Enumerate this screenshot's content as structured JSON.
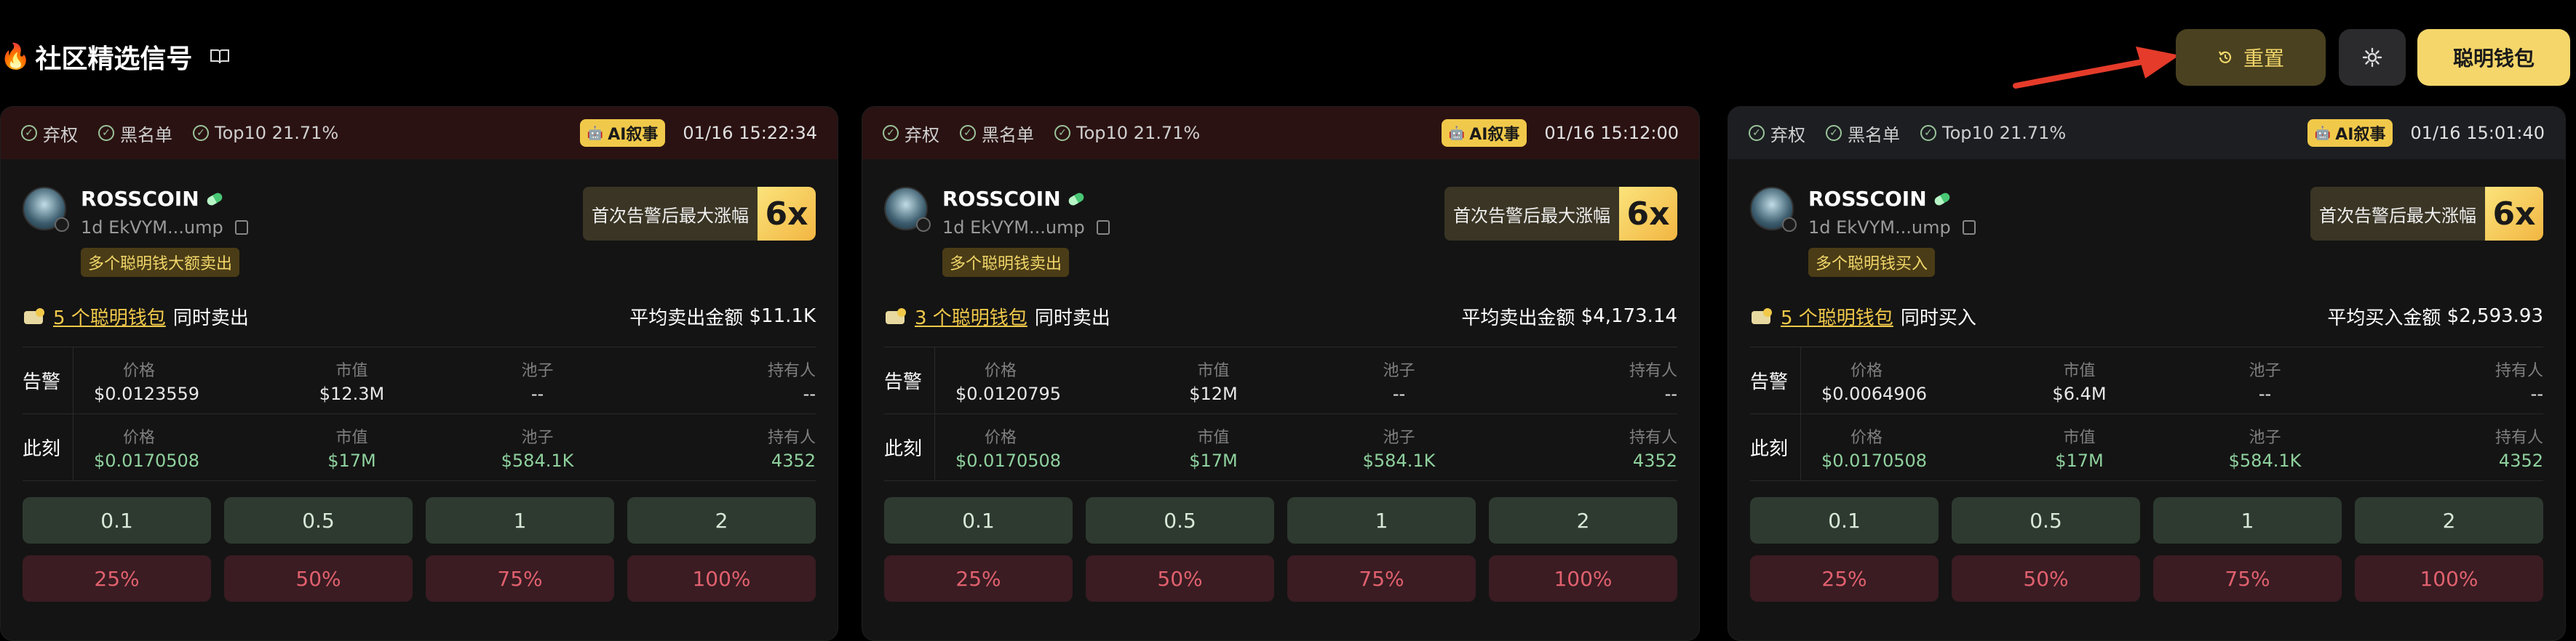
{
  "header": {
    "fire_icon": "fire-icon",
    "title": "社区精选信号",
    "reset_label": "重置",
    "smart_wallet_label": "聪明钱包",
    "colors": {
      "reset_bg": "#4a4120",
      "reset_text": "#f1d66a",
      "smart_bg": "#f5d66a",
      "arrow": "#e53b2a"
    }
  },
  "labels": {
    "check_1": "弃权",
    "check_2": "黑名单",
    "check_3": "Top10 21.71%",
    "ai_tag": "AI叙事",
    "gain_label": "首次告警后最大涨幅",
    "gain_value": "6x",
    "alert_row": "告警",
    "now_row": "此刻",
    "col_price": "价格",
    "col_mcap": "市值",
    "col_pool": "池子",
    "col_holders": "持有人"
  },
  "buy_buttons": [
    "0.1",
    "0.5",
    "1",
    "2"
  ],
  "sell_buttons": [
    "25%",
    "50%",
    "75%",
    "100%"
  ],
  "cards": [
    {
      "timestamp": "01/16 15:22:34",
      "token_name": "ROSSCOIN",
      "token_sub": "1d EkVYM...ump",
      "tag": "多个聪明钱大额卖出",
      "wallet_link": "5 个聪明钱包",
      "action": "同时卖出",
      "avg_label": "平均卖出金额",
      "avg_value": "$11.1K",
      "alert": {
        "price": "$0.0123559",
        "mcap": "$12.3M",
        "pool": "--",
        "holders": "--"
      },
      "now": {
        "price": "$0.0170508",
        "mcap": "$17M",
        "pool": "$584.1K",
        "holders": "4352"
      }
    },
    {
      "timestamp": "01/16 15:12:00",
      "token_name": "ROSSCOIN",
      "token_sub": "1d EkVYM...ump",
      "tag": "多个聪明钱卖出",
      "wallet_link": "3 个聪明钱包",
      "action": "同时卖出",
      "avg_label": "平均卖出金额",
      "avg_value": "$4,173.14",
      "alert": {
        "price": "$0.0120795",
        "mcap": "$12M",
        "pool": "--",
        "holders": "--"
      },
      "now": {
        "price": "$0.0170508",
        "mcap": "$17M",
        "pool": "$584.1K",
        "holders": "4352"
      }
    },
    {
      "timestamp": "01/16 15:01:40",
      "token_name": "ROSSCOIN",
      "token_sub": "1d EkVYM...ump",
      "tag": "多个聪明钱买入",
      "wallet_link": "5 个聪明钱包",
      "action": "同时买入",
      "avg_label": "平均买入金额",
      "avg_value": "$2,593.93",
      "alert": {
        "price": "$0.0064906",
        "mcap": "$6.4M",
        "pool": "--",
        "holders": "--"
      },
      "now": {
        "price": "$0.0170508",
        "mcap": "$17M",
        "pool": "$584.1K",
        "holders": "4352"
      }
    }
  ]
}
